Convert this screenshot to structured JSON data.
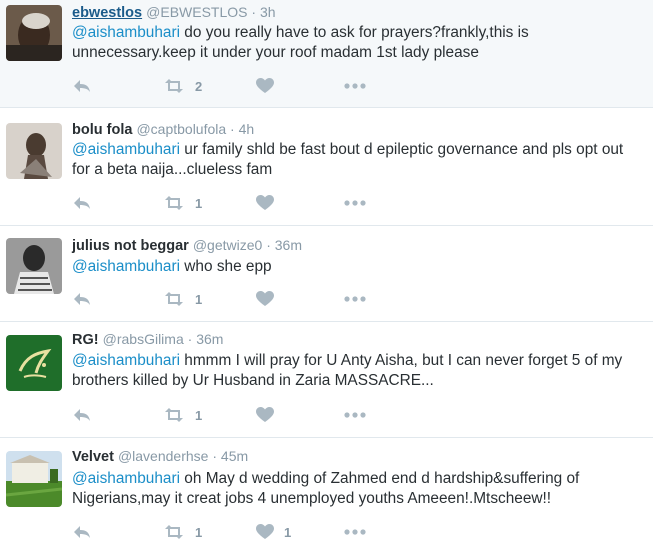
{
  "tweets": [
    {
      "name": "ebwestlos",
      "handle": "@EBWESTLOS",
      "time": "3h",
      "mention": "@aishambuhari",
      "text": " do you really have to ask for prayers?frankly,this is unnecessary.keep it under your roof madam 1st lady please",
      "retweets": "2",
      "likes": ""
    },
    {
      "name": "bolu fola",
      "handle": "@captbolufola",
      "time": "4h",
      "mention": "@aishambuhari",
      "text": " ur family shld be fast bout d epileptic governance and pls opt out for a beta naija...clueless fam",
      "retweets": "1",
      "likes": ""
    },
    {
      "name": "julius not beggar",
      "handle": "@getwize0",
      "time": "36m",
      "mention": "@aishambuhari",
      "text": " who she epp",
      "retweets": "1",
      "likes": ""
    },
    {
      "name": "RG!",
      "handle": "@rabsGilima",
      "time": "36m",
      "mention": "@aishambuhari",
      "text": " hmmm I will pray for U Anty Aisha, but I can never forget 5 of my brothers killed by Ur Husband in Zaria MASSACRE...",
      "retweets": "1",
      "likes": ""
    },
    {
      "name": "Velvet",
      "handle": "@lavenderhse",
      "time": "45m",
      "mention": "@aishambuhari",
      "text": " oh May d wedding of Zahmed end d hardship&suffering of Nigerians,may it creat jobs 4 unemployed youths Ameeen!.Mtscheew!!",
      "retweets": "1",
      "likes": "1"
    }
  ],
  "separator": " · ",
  "colors": {
    "mention": "#1b8ec8",
    "meta": "#8899a6",
    "icon": "#aab8c2",
    "highlight_bg": "#f5f8fa"
  },
  "icons": {
    "reply": "reply-icon",
    "retweet": "retweet-icon",
    "like": "heart-icon",
    "more": "more-icon"
  }
}
